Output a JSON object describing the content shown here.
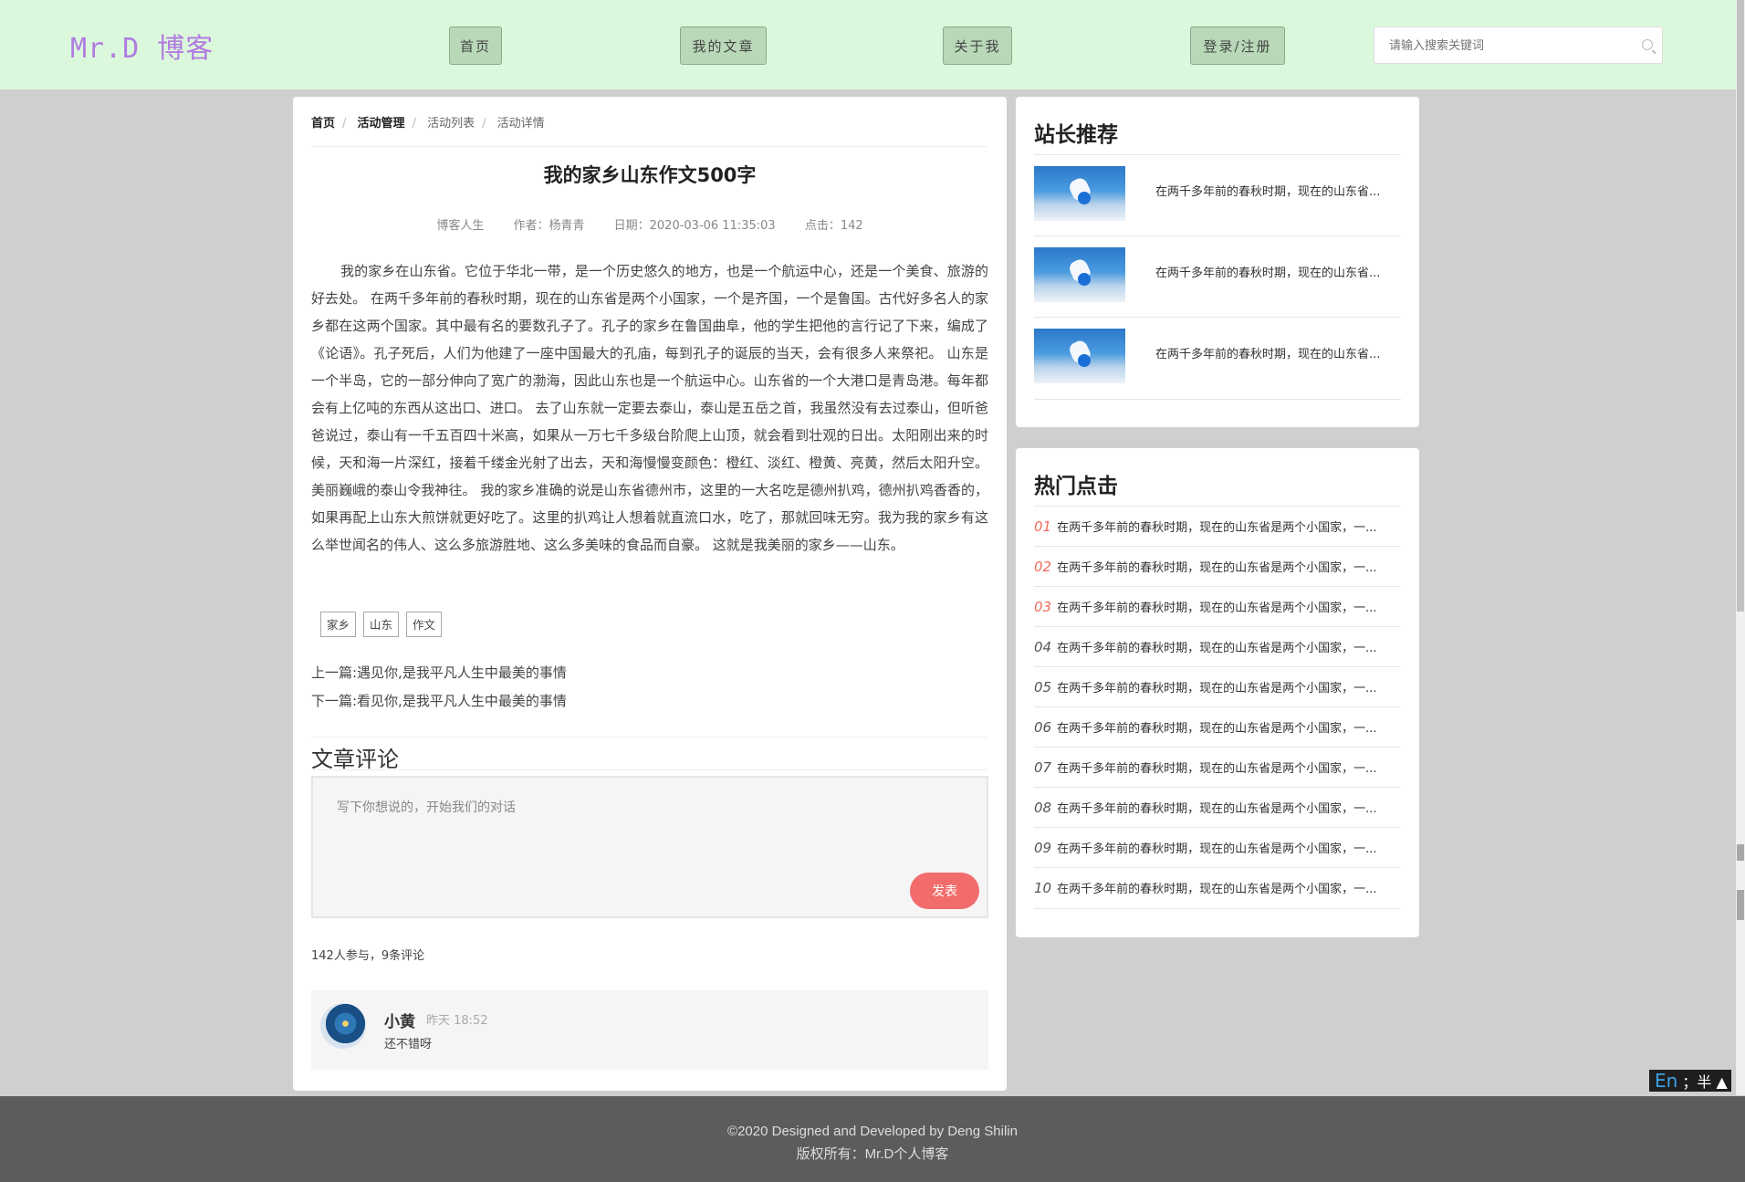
{
  "header": {
    "logo": "Mr.D 博客",
    "nav": [
      "首页",
      "我的文章",
      "关于我",
      "登录/注册"
    ],
    "search_placeholder": "请输入搜索关键词"
  },
  "breadcrumb": [
    "首页",
    "活动管理",
    "活动列表",
    "活动详情"
  ],
  "article": {
    "title": "我的家乡山东作文500字",
    "category": "博客人生",
    "author": "作者：杨青青",
    "date": "日期：2020-03-06 11:35:03",
    "clicks": "点击：142",
    "body": "我的家乡在山东省。它位于华北一带，是一个历史悠久的地方，也是一个航运中心，还是一个美食、旅游的好去处。 在两千多年前的春秋时期，现在的山东省是两个小国家，一个是齐国，一个是鲁国。古代好多名人的家乡都在这两个国家。其中最有名的要数孔子了。孔子的家乡在鲁国曲阜，他的学生把他的言行记了下来，编成了《论语》。孔子死后，人们为他建了一座中国最大的孔庙，每到孔子的诞辰的当天，会有很多人来祭祀。 山东是一个半岛，它的一部分伸向了宽广的渤海，因此山东也是一个航运中心。山东省的一个大港口是青岛港。每年都会有上亿吨的东西从这出口、进口。 去了山东就一定要去泰山，泰山是五岳之首，我虽然没有去过泰山，但听爸爸说过，泰山有一千五百四十米高，如果从一万七千多级台阶爬上山顶，就会看到壮观的日出。太阳刚出来的时候，天和海一片深红，接着千缕金光射了出去，天和海慢慢变颜色：橙红、淡红、橙黄、亮黄，然后太阳升空。美丽巍峨的泰山令我神往。 我的家乡准确的说是山东省德州市，这里的一大名吃是德州扒鸡，德州扒鸡香香的，如果再配上山东大煎饼就更好吃了。这里的扒鸡让人想着就直流口水，吃了，那就回味无穷。我为我的家乡有这么举世闻名的伟人、这么多旅游胜地、这么多美味的食品而自豪。 这就是我美丽的家乡——山东。",
    "tags": [
      "家乡",
      "山东",
      "作文"
    ],
    "prev": "上一篇:遇见你,是我平凡人生中最美的事情",
    "next": "下一篇:看见你,是我平凡人生中最美的事情"
  },
  "comments": {
    "title": "文章评论",
    "placeholder": "写下你想说的，开始我们的对话",
    "submit": "发表",
    "stats": "142人参与，9条评论",
    "items": [
      {
        "name": "小黄",
        "time": "昨天 18:52",
        "text": "还不错呀"
      }
    ]
  },
  "sidebar": {
    "recommend_title": "站长推荐",
    "recommend": [
      "在两千多年前的春秋时期，现在的山东省...",
      "在两千多年前的春秋时期，现在的山东省...",
      "在两千多年前的春秋时期，现在的山东省..."
    ],
    "hot_title": "热门点击",
    "hot": [
      {
        "num": "01",
        "text": "在两千多年前的春秋时期，现在的山东省是两个小国家，一..."
      },
      {
        "num": "02",
        "text": "在两千多年前的春秋时期，现在的山东省是两个小国家，一..."
      },
      {
        "num": "03",
        "text": "在两千多年前的春秋时期，现在的山东省是两个小国家，一..."
      },
      {
        "num": "04",
        "text": "在两千多年前的春秋时期，现在的山东省是两个小国家，一..."
      },
      {
        "num": "05",
        "text": "在两千多年前的春秋时期，现在的山东省是两个小国家，一..."
      },
      {
        "num": "06",
        "text": "在两千多年前的春秋时期，现在的山东省是两个小国家，一..."
      },
      {
        "num": "07",
        "text": "在两千多年前的春秋时期，现在的山东省是两个小国家，一..."
      },
      {
        "num": "08",
        "text": "在两千多年前的春秋时期，现在的山东省是两个小国家，一..."
      },
      {
        "num": "09",
        "text": "在两千多年前的春秋时期，现在的山东省是两个小国家，一..."
      },
      {
        "num": "10",
        "text": "在两千多年前的春秋时期，现在的山东省是两个小国家，一..."
      }
    ]
  },
  "ime": {
    "lang": "En",
    "mode": "；半"
  },
  "footer": {
    "line1": "©2020 Designed and Developed by Deng Shilin",
    "line2": "版权所有：Mr.D个人博客"
  },
  "colors": {
    "header_bg": "#dcf8dc",
    "logo": "#b07be0",
    "accent": "#f26c6c"
  }
}
